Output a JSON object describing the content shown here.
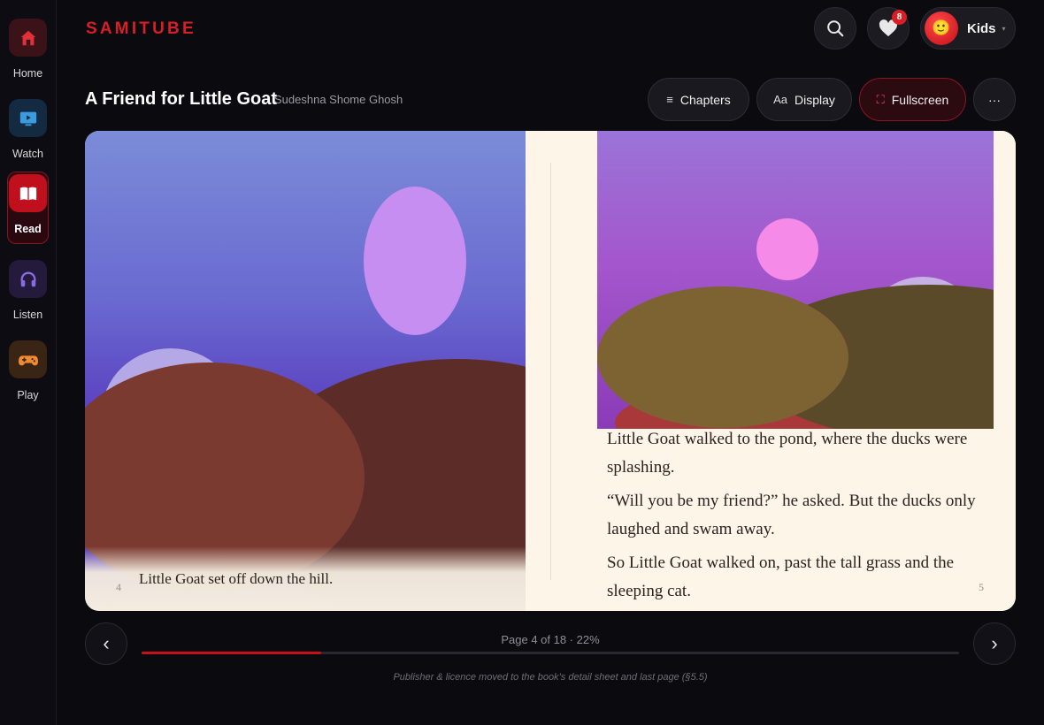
{
  "sidebar": {
    "items": [
      {
        "label": "Home",
        "icon": "home-icon",
        "color": "#e0303a"
      },
      {
        "label": "Watch",
        "icon": "tv-icon",
        "color": "#3a9be0"
      },
      {
        "label": "Read",
        "icon": "book-icon",
        "color": "#ffffff",
        "active": true
      },
      {
        "label": "Listen",
        "icon": "headphones-icon",
        "color": "#8a6be0"
      },
      {
        "label": "Play",
        "icon": "gamepad-icon",
        "color": "#f08a30"
      }
    ]
  },
  "header": {
    "logo": "SAMITUBE",
    "favorites_count": "8",
    "profile_name": "Kids",
    "avatar_emoji": "🙂"
  },
  "book": {
    "title": "A Friend for Little Goat",
    "author": "Sudeshna Shome Ghosh"
  },
  "toolbar": {
    "chapters_label": "Chapters",
    "chapters_icon": "≡",
    "display_label": "Display",
    "display_icon": "Aa",
    "fullscreen_label": "Fullscreen",
    "fullscreen_icon": "⛶",
    "more_label": "···"
  },
  "spread": {
    "left": {
      "caption": "Little Goat set off down the hill.",
      "page_number": "4"
    },
    "right": {
      "paragraphs": [
        "Little Goat walked to the pond, where the ducks were splashing.",
        "“Will you be my friend?” he asked. But the ducks only laughed and swam away.",
        "So Little Goat walked on, past the tall grass and the sleeping cat."
      ],
      "page_number": "5"
    }
  },
  "progress": {
    "text": "Page 4 of 18 · 22%",
    "fraction": 0.22,
    "prev_label": "‹",
    "next_label": "›"
  },
  "footnote": "Publisher & licence moved to the book’s detail sheet and last page (§5.5)",
  "colors": {
    "accent": "#d81f26",
    "page_background": "#fdf5e8"
  }
}
